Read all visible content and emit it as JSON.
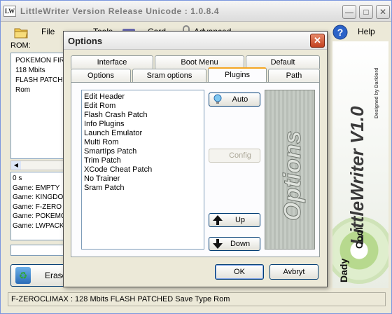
{
  "main_window": {
    "title": "LittleWriter Version Release Unicode : 1.0.8.4",
    "icon_text": "LW",
    "menu": [
      {
        "label": "File",
        "icon": "folder-icon"
      },
      {
        "label": "Tools",
        "icon": "tools-icon"
      },
      {
        "label": "Card",
        "icon": "card-icon"
      },
      {
        "label": "Advanced",
        "icon": "lock-icon"
      },
      {
        "label": "Help",
        "icon": "help-icon"
      }
    ],
    "rom_label": "ROM:",
    "rom_info": [
      "POKEMON FIR",
      "118 Mbits",
      "FLASH PATCH",
      "Rom"
    ],
    "log": [
      "0 s",
      "Game: EMPTY",
      "Game: KINGDO",
      "Game: F-ZERO",
      "Game: POKEMO",
      "Game: LWPACK"
    ],
    "erase_label": "Erase",
    "status": "F-ZEROCLIMAX : 128 Mbits FLASH PATCHED Save Type Rom",
    "side_art": {
      "title": "LittleWriter V1.0",
      "credit": "Designed by Darklord",
      "brand_left": "Dady",
      "brand_right": "Cool"
    }
  },
  "dialog": {
    "title": "Options",
    "tabs_back": [
      "Interface",
      "Boot Menu",
      "Default"
    ],
    "tabs_front": [
      "Options",
      "Sram options",
      "Plugins",
      "Path"
    ],
    "active_tab": "Plugins",
    "plugins": [
      "Edit Header",
      "Edit Rom",
      "Flash Crash Patch",
      "Info Plugins",
      "Launch Emulator",
      "Multi Rom",
      "SmartIps Patch",
      "Trim Patch",
      "XCode Cheat Patch",
      "No Trainer",
      "Sram Patch"
    ],
    "buttons": {
      "auto": "Auto",
      "config": "Config",
      "up": "Up",
      "down": "Down",
      "ok": "OK",
      "cancel": "Avbryt"
    },
    "art_text": "Options"
  }
}
